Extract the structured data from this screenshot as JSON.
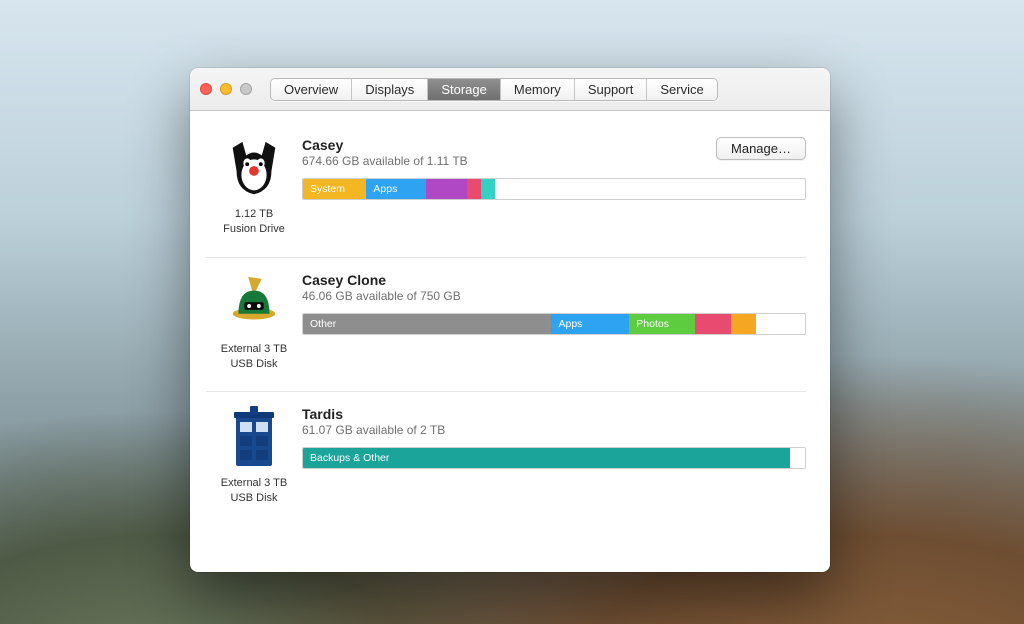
{
  "tabs": [
    {
      "id": "overview",
      "label": "Overview",
      "selected": false
    },
    {
      "id": "displays",
      "label": "Displays",
      "selected": false
    },
    {
      "id": "storage",
      "label": "Storage",
      "selected": true
    },
    {
      "id": "memory",
      "label": "Memory",
      "selected": false
    },
    {
      "id": "support",
      "label": "Support",
      "selected": false
    },
    {
      "id": "service",
      "label": "Service",
      "selected": false
    }
  ],
  "manage_label": "Manage…",
  "drives": [
    {
      "id": "casey",
      "name": "Casey",
      "available_text": "674.66 GB available of 1.11 TB",
      "icon_caption_line1": "1.12 TB",
      "icon_caption_line2": "Fusion Drive",
      "icon_kind": "sylvester",
      "has_manage": true,
      "segments": [
        {
          "label": "System",
          "percent": 12.9,
          "color": "#f5b623"
        },
        {
          "label": "Apps",
          "percent": 12.2,
          "color": "#2ea3f2"
        },
        {
          "label": "",
          "percent": 8.3,
          "color": "#b047c4"
        },
        {
          "label": "",
          "percent": 2.3,
          "color": "#e94a6f"
        },
        {
          "label": "",
          "percent": 1.0,
          "color": "#32d1c3"
        },
        {
          "label": "",
          "percent": 63.3,
          "color": "#ffffff",
          "free": true
        }
      ]
    },
    {
      "id": "casey-clone",
      "name": "Casey Clone",
      "available_text": "46.06 GB available of 750 GB",
      "icon_caption_line1": "External 3 TB",
      "icon_caption_line2": "USB Disk",
      "icon_kind": "marvin",
      "has_manage": false,
      "segments": [
        {
          "label": "Other",
          "percent": 49.5,
          "color": "#8e8e8e"
        },
        {
          "label": "Apps",
          "percent": 15.5,
          "color": "#2ea3f2"
        },
        {
          "label": "Photos",
          "percent": 13.0,
          "color": "#5ecc3f"
        },
        {
          "label": "",
          "percent": 7.3,
          "color": "#e94a6f"
        },
        {
          "label": "",
          "percent": 5.0,
          "color": "#f5a623"
        },
        {
          "label": "",
          "percent": 3.6,
          "color": "#ffffff",
          "free": true
        }
      ]
    },
    {
      "id": "tardis",
      "name": "Tardis",
      "available_text": "61.07 GB available of 2 TB",
      "icon_caption_line1": "External 3 TB",
      "icon_caption_line2": "USB Disk",
      "icon_kind": "tardis",
      "has_manage": false,
      "segments": [
        {
          "label": "Backups & Other",
          "percent": 97.1,
          "color": "#1aa49a"
        },
        {
          "label": "",
          "percent": 2.9,
          "color": "#ffffff",
          "free": true
        }
      ]
    }
  ]
}
